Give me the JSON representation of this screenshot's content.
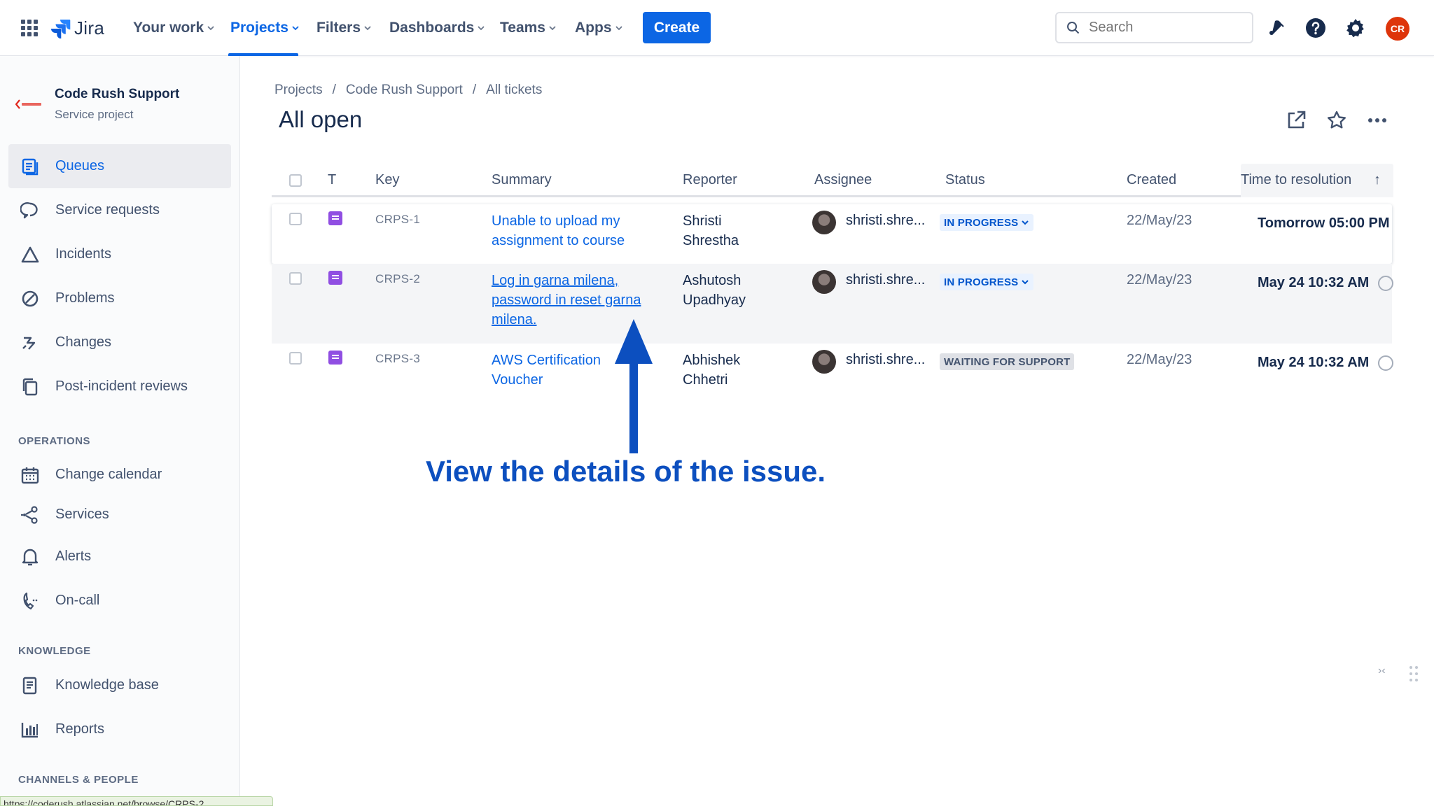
{
  "app": {
    "name": "Jira"
  },
  "topnav": {
    "items": [
      {
        "label": "Your work"
      },
      {
        "label": "Projects"
      },
      {
        "label": "Filters"
      },
      {
        "label": "Dashboards"
      },
      {
        "label": "Teams"
      },
      {
        "label": "Apps"
      }
    ],
    "active": "Projects",
    "create_label": "Create",
    "search_placeholder": "Search",
    "avatar_initials": "CR"
  },
  "sidebar": {
    "project_name": "Code Rush Support",
    "project_type": "Service project",
    "items": [
      {
        "label": "Queues",
        "icon": "queues-icon"
      },
      {
        "label": "Service requests",
        "icon": "chat-icon"
      },
      {
        "label": "Incidents",
        "icon": "warning-triangle-icon"
      },
      {
        "label": "Problems",
        "icon": "no-entry-icon"
      },
      {
        "label": "Changes",
        "icon": "changes-icon"
      },
      {
        "label": "Post-incident reviews",
        "icon": "copy-icon"
      }
    ],
    "operations_title": "OPERATIONS",
    "operations": [
      {
        "label": "Change calendar",
        "icon": "calendar-icon"
      },
      {
        "label": "Services",
        "icon": "share-nodes-icon"
      },
      {
        "label": "Alerts",
        "icon": "bell-icon"
      },
      {
        "label": "On-call",
        "icon": "phone-icon"
      }
    ],
    "knowledge_title": "KNOWLEDGE",
    "knowledge": [
      {
        "label": "Knowledge base",
        "icon": "book-icon"
      },
      {
        "label": "Reports",
        "icon": "bar-chart-icon"
      }
    ],
    "channels_title": "CHANNELS & PEOPLE"
  },
  "breadcrumb": [
    "Projects",
    "Code Rush Support",
    "All tickets"
  ],
  "page_title": "All open",
  "table": {
    "headers": [
      "T",
      "Key",
      "Summary",
      "Reporter",
      "Assignee",
      "Status",
      "Created",
      "Time to resolution"
    ],
    "sort_indicator": "↑",
    "rows": [
      {
        "key": "CRPS-1",
        "summary": "Unable to upload my assignment to course",
        "reporter": "Shristi Shrestha",
        "assignee": "shristi.shre...",
        "status": "IN PROGRESS",
        "created": "22/May/23",
        "ttr": "Tomorrow 05:00 PM"
      },
      {
        "key": "CRPS-2",
        "summary": "Log in garna milena, password in reset garna milena.",
        "reporter": "Ashutosh Upadhyay",
        "assignee": "shristi.shre...",
        "status": "IN PROGRESS",
        "created": "22/May/23",
        "ttr": "May 24 10:32 AM"
      },
      {
        "key": "CRPS-3",
        "summary": "AWS Certification Voucher",
        "reporter": "Abhishek Chhetri",
        "assignee": "shristi.shre...",
        "status": "WAITING FOR SUPPORT",
        "created": "22/May/23",
        "ttr": "May 24 10:32 AM"
      }
    ]
  },
  "annotation": {
    "text": "View the details of the issue."
  },
  "status_url": "https://coderush.atlassian.net/browse/CRPS-2",
  "colors": {
    "accent": "#0c66e4",
    "annotation": "#0c4fbf",
    "avatar": "#de350b",
    "issue_type": "#904ee2"
  }
}
